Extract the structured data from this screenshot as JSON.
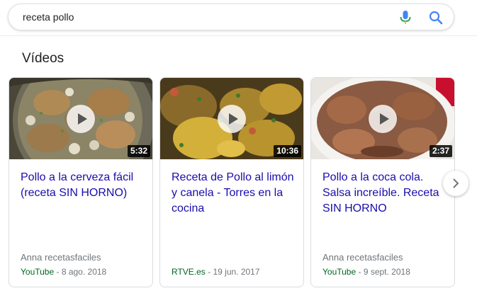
{
  "search": {
    "query": "receta pollo"
  },
  "section": {
    "title": "Vídeos"
  },
  "videos": [
    {
      "title": "Pollo a la cerveza fácil (receta SIN HORNO)",
      "duration": "5:32",
      "author": "Anna recetasfaciles",
      "source": "YouTube",
      "separator": " - ",
      "date": "8 ago. 2018"
    },
    {
      "title": "Receta de Pollo al limón y canela - Torres en la cocina",
      "duration": "10:36",
      "author": "",
      "source": "RTVE.es",
      "separator": " - ",
      "date": "19 jun. 2017"
    },
    {
      "title": "Pollo a la coca cola. Salsa increíble. Receta SIN HORNO",
      "duration": "2:37",
      "author": "Anna recetasfaciles",
      "source": "YouTube",
      "separator": " - ",
      "date": "9 sept. 2018"
    }
  ],
  "icons": {
    "mic": "microphone-icon",
    "search": "search-icon",
    "next": "chevron-right-icon",
    "play": "play-icon"
  },
  "colors": {
    "link": "#1a0dab",
    "source": "#006621",
    "meta": "#70757a",
    "search_blue": "#4285f4"
  }
}
